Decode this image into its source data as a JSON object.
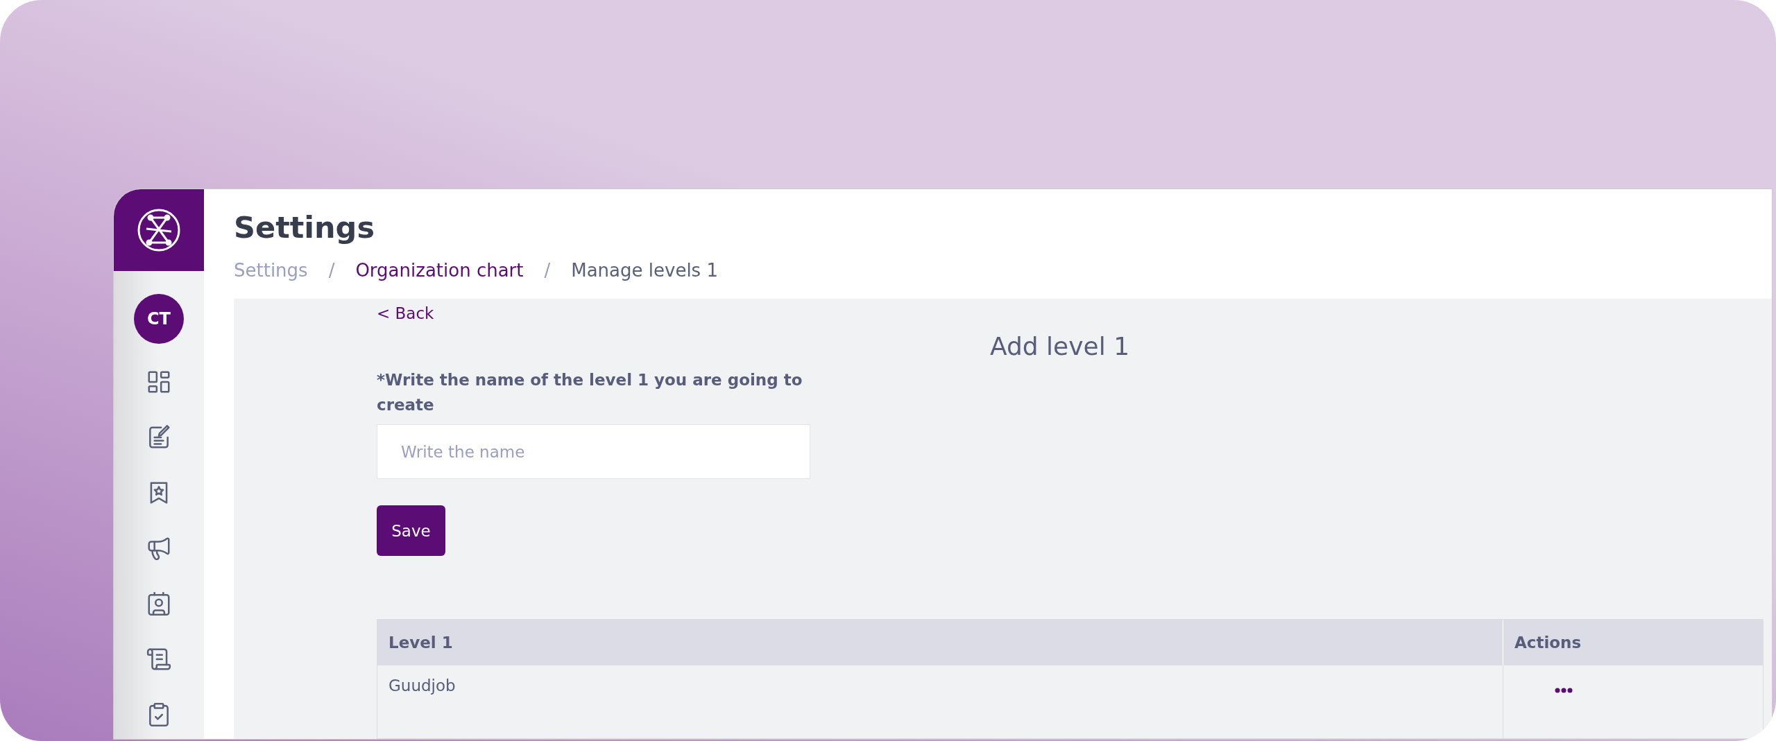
{
  "sidebar": {
    "avatar": "CT"
  },
  "header": {
    "title": "Settings",
    "breadcrumb": [
      {
        "label": "Settings",
        "kind": "muted"
      },
      {
        "label": "/",
        "kind": "separator"
      },
      {
        "label": "Organization chart",
        "kind": "link"
      },
      {
        "label": "/",
        "kind": "separator"
      },
      {
        "label": "Manage levels 1",
        "kind": "current"
      }
    ]
  },
  "form": {
    "back": "< Back",
    "heading": "Add level 1",
    "label": "*Write the name of the level 1 you are going to create",
    "placeholder": "Write the name",
    "save": "Save"
  },
  "table": {
    "columns": [
      "Level 1",
      "Actions"
    ],
    "rows": [
      {
        "name": "Guudjob"
      }
    ]
  }
}
